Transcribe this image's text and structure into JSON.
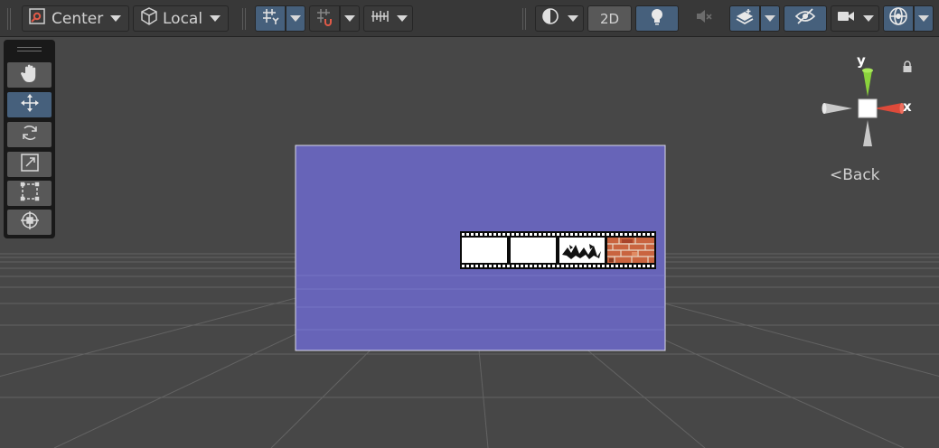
{
  "toolbar": {
    "pivot_position_label": "Center",
    "pivot_rotation_label": "Local",
    "mode_2d_label": "2D"
  },
  "tools": [
    "hand",
    "move",
    "rotate",
    "scale",
    "rect",
    "transform"
  ],
  "gizmo": {
    "y_label": "y",
    "x_label": "x",
    "back_label": "Back"
  },
  "colors": {
    "panel_fill": "#6764b8",
    "toolbar_bg": "#383838",
    "scene_bg": "#474747",
    "active_blue": "#46607c",
    "gizmo_y": "#8ad23c",
    "gizmo_x": "#dd4a3a"
  }
}
